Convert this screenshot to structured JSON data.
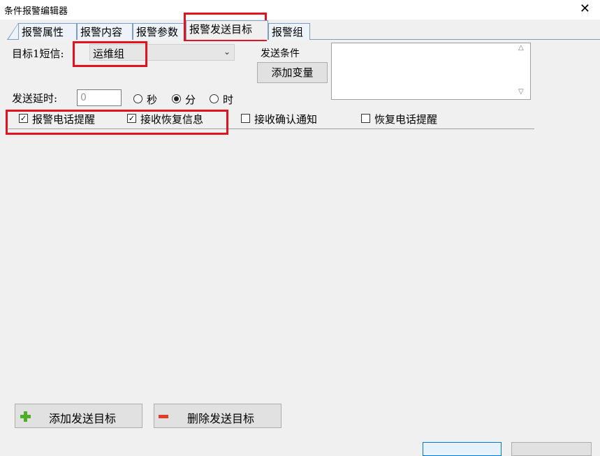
{
  "window": {
    "title": "条件报警编辑器",
    "close_glyph": "✕"
  },
  "tabs": [
    {
      "label": "报警属性",
      "active": false
    },
    {
      "label": "报警内容",
      "active": false
    },
    {
      "label": "报警参数",
      "active": false
    },
    {
      "label": "报警发送目标",
      "active": true
    },
    {
      "label": "报警组",
      "active": false
    }
  ],
  "target": {
    "label": "目标1短信:",
    "selected": "运维组"
  },
  "send_condition": {
    "label": "发送条件",
    "add_variable_button": "添加变量",
    "text": ""
  },
  "delay": {
    "label": "发送延时:",
    "value": "0",
    "units": [
      {
        "label": "秒",
        "selected": false
      },
      {
        "label": "分",
        "selected": true
      },
      {
        "label": "时",
        "selected": false
      }
    ]
  },
  "options": [
    {
      "label": "报警电话提醒",
      "checked": true
    },
    {
      "label": "接收恢复信息",
      "checked": true
    },
    {
      "label": "接收确认通知",
      "checked": false
    },
    {
      "label": "恢复电话提醒",
      "checked": false
    }
  ],
  "buttons": {
    "add_target": "添加发送目标",
    "remove_target": "删除发送目标"
  },
  "icons": {
    "add": "plus-icon",
    "remove": "minus-icon",
    "dropdown": "chevron-down-icon"
  },
  "colors": {
    "highlight": "#e0141e",
    "add_icon": "#4caf27",
    "remove_icon": "#e43b28"
  }
}
